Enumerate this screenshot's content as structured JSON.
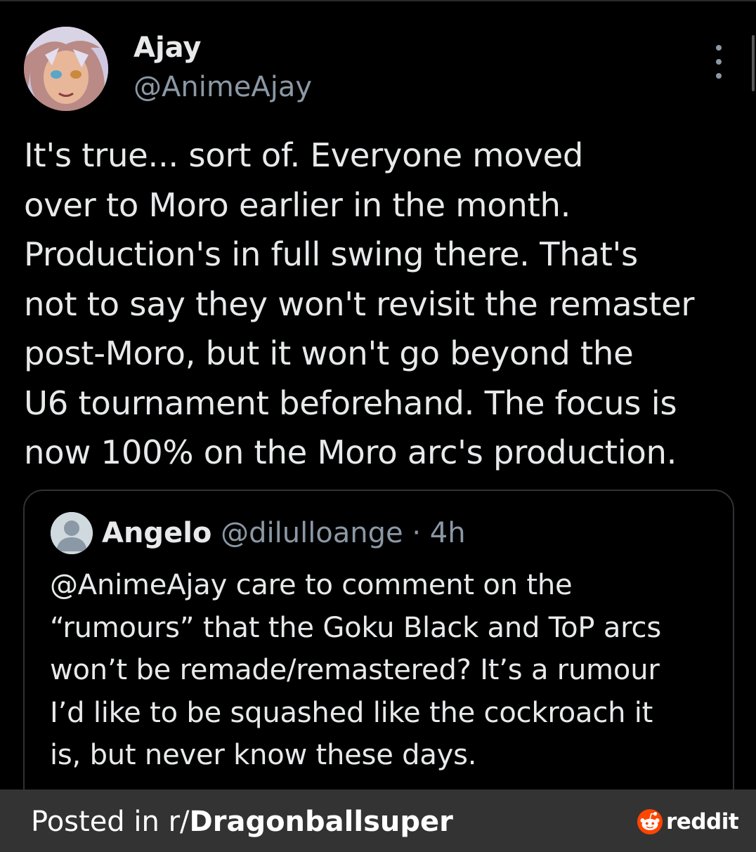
{
  "author": {
    "name": "Ajay",
    "handle": "@AnimeAjay",
    "avatar_icon": "anime-character-avatar"
  },
  "menu": {
    "icon": "more-vertical-icon"
  },
  "tweet": {
    "text": "It's true... sort of. Everyone moved\nover to Moro earlier in the month.\nProduction's in full swing there. That's\nnot to say they won't revisit the remaster\npost-Moro, but it won't go beyond the\nU6 tournament beforehand. The focus is\nnow 100% on the Moro arc's production."
  },
  "quoted_tweet": {
    "name": "Angelo",
    "handle": "@dilulloange",
    "separator": "·",
    "time": "4h",
    "avatar_icon": "default-user-icon",
    "text": "@AnimeAjay care to comment on the\n“rumours” that the Goku Black and ToP arcs\nwon’t be remade/remastered? It’s a rumour\nI’d like to be squashed like the cockroach it\nis, but never know these days."
  },
  "footer": {
    "prefix": "Posted in r/",
    "subreddit": "Dragonballsuper",
    "brand": "reddit",
    "brand_icon": "reddit-snoo-icon",
    "brand_color": "#ff4500"
  },
  "colors": {
    "background": "#000000",
    "text_primary": "#e7e9ea",
    "text_secondary": "#8b98a5",
    "footer_bg": "#333333"
  }
}
